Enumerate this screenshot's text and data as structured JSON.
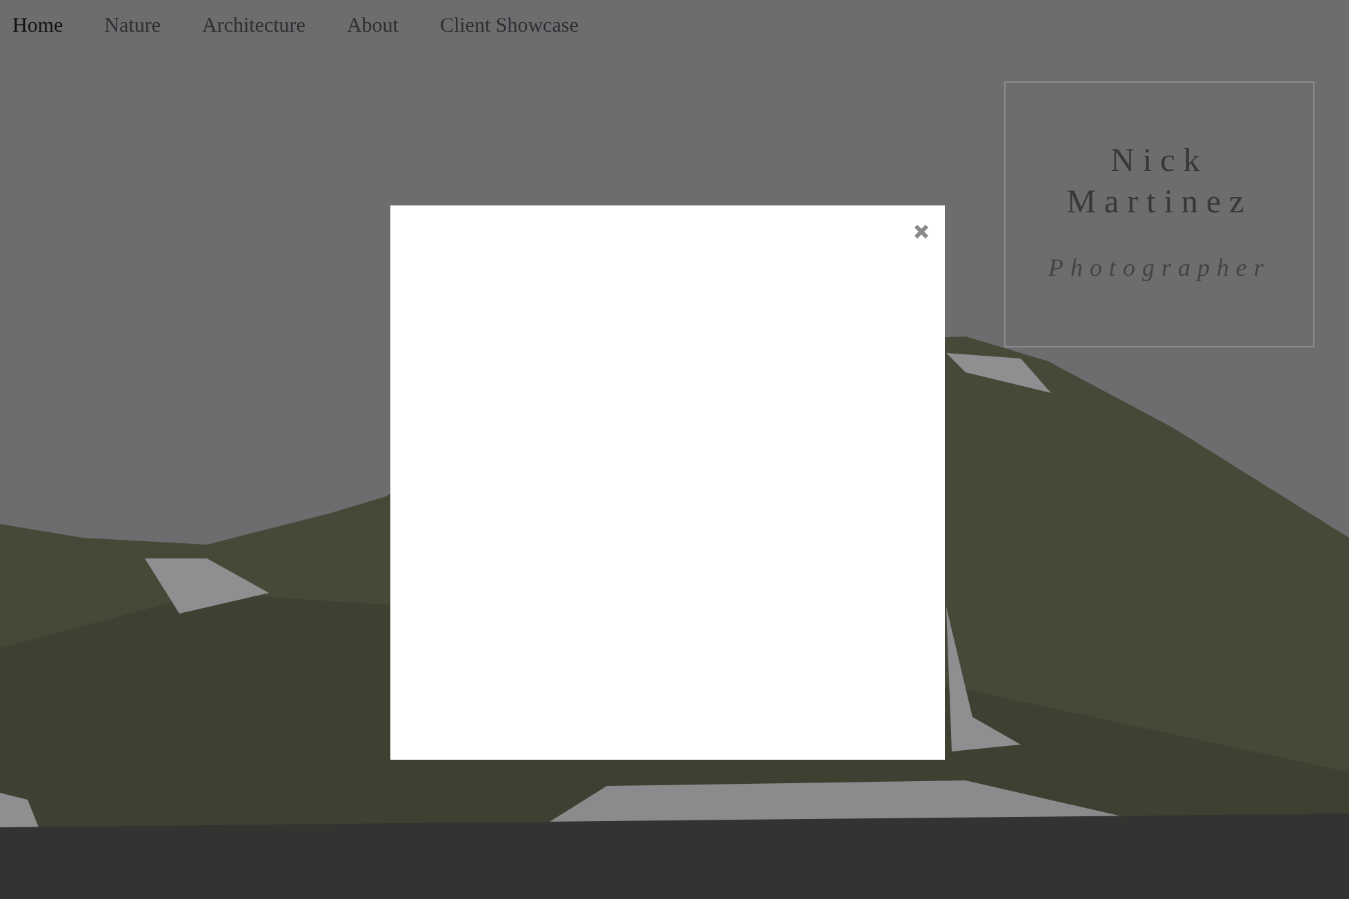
{
  "nav": {
    "items": [
      {
        "label": "Home",
        "selected": true
      },
      {
        "label": "Nature",
        "selected": false
      },
      {
        "label": "Architecture",
        "selected": false
      },
      {
        "label": "About",
        "selected": false
      },
      {
        "label": "Client Showcase",
        "selected": false
      }
    ]
  },
  "title_card": {
    "name": "Nick Martinez",
    "role": "Photographer"
  },
  "modal": {
    "open": true
  }
}
